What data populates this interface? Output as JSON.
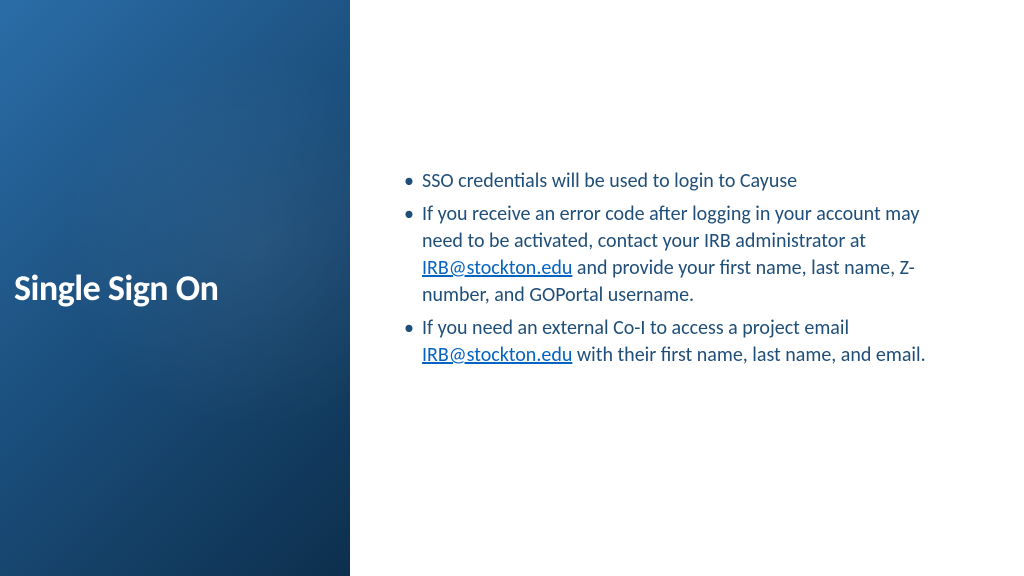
{
  "slide": {
    "title": "Single Sign On"
  },
  "content": {
    "bullets": [
      {
        "text": "SSO credentials will be used to login to Cayuse"
      },
      {
        "prefix": "If you receive an error code after logging in your account may need to be activated, contact your IRB administrator at ",
        "link": "IRB@stockton.edu",
        "suffix": " and provide your first name, last name, Z-number, and GOPortal username."
      },
      {
        "prefix": "If you need an external Co-I to access a project email ",
        "link": "IRB@stockton.edu",
        "suffix": " with their first name, last name, and email."
      }
    ]
  }
}
